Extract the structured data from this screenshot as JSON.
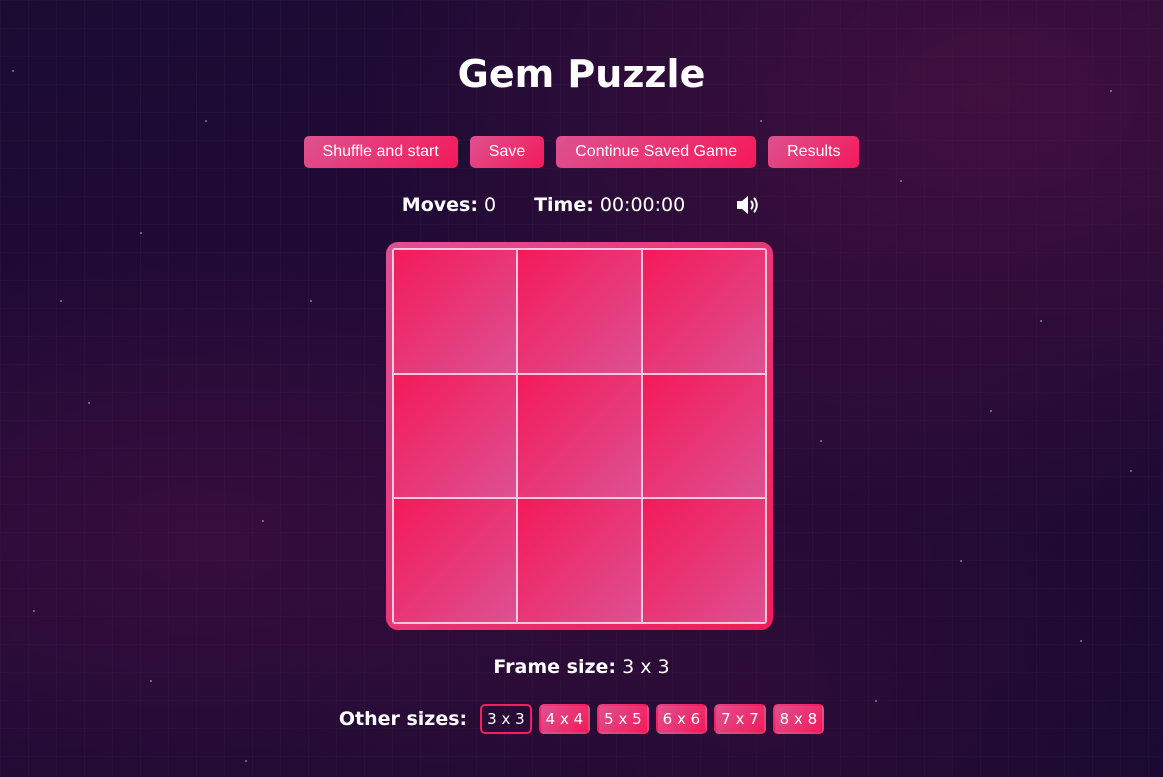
{
  "title": "Gem Puzzle",
  "toolbar": {
    "shuffle_label": "Shuffle and start",
    "save_label": "Save",
    "continue_label": "Continue Saved Game",
    "results_label": "Results"
  },
  "stats": {
    "moves_label": "Moves:",
    "moves_value": "0",
    "time_label": "Time:",
    "time_value": "00:00:00",
    "sound_icon": "speaker-volume-icon"
  },
  "board": {
    "rows": 3,
    "cols": 3,
    "tiles": [
      "",
      "",
      "",
      "",
      "",
      "",
      "",
      "",
      ""
    ]
  },
  "frame": {
    "label": "Frame size:",
    "value": "3 x 3"
  },
  "other_sizes": {
    "label": "Other sizes:",
    "options": [
      "3 x 3",
      "4 x 4",
      "5 x 5",
      "6 x 6",
      "7 x 7",
      "8 x 8"
    ],
    "selected": "3 x 3"
  },
  "colors": {
    "accent": "#f41a59",
    "accent_light": "#dd5290",
    "background": "#1d0a35"
  }
}
